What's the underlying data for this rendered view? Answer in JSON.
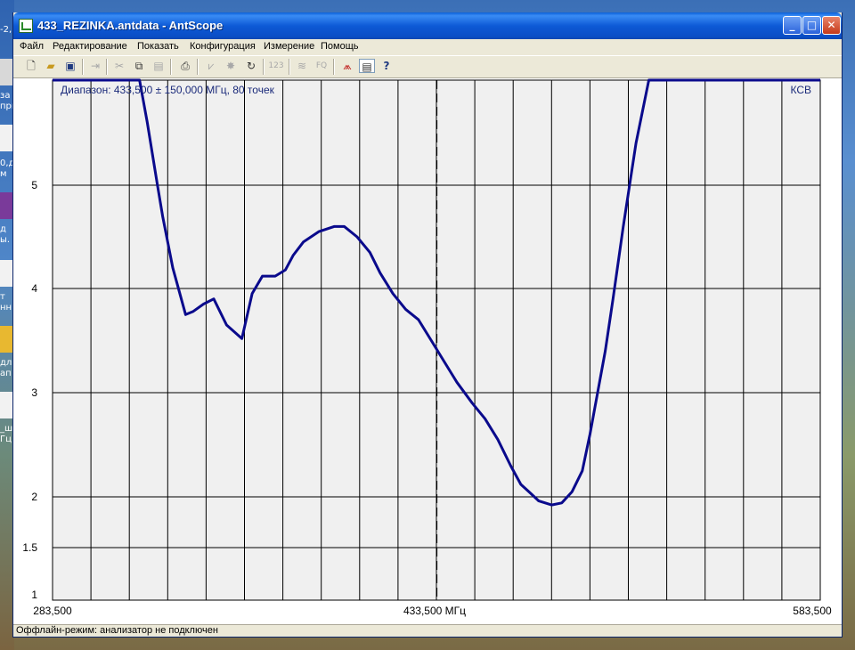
{
  "window": {
    "title": "433_REZINKA.antdata - AntScope",
    "buttons": {
      "minimize": "_",
      "maximize": "□",
      "close": "✕"
    }
  },
  "menu": [
    "Файл",
    "Редактирование",
    "Показать",
    "Конфигурация",
    "Измерение",
    "Помощь"
  ],
  "toolbar": {
    "tools": [
      "new-icon",
      "open-icon",
      "save-icon",
      "export-icon",
      "cut-icon",
      "copy-icon",
      "paste-icon",
      "print-icon",
      "graph-icon",
      "star-icon",
      "refresh-icon",
      "123-icon",
      "wifi-icon",
      "fq-icon",
      "chart-mode-icon",
      "table-icon",
      "help-icon"
    ],
    "labels": {
      "num": "123",
      "fq": "FQ",
      "help": "?"
    }
  },
  "desktop": {
    "labels": [
      "-2,",
      "за",
      "при",
      "0,д",
      "м",
      "д",
      "ы.",
      "т",
      "нн.",
      "дл",
      "ап",
      "_ш",
      "Гц"
    ]
  },
  "chart_data": {
    "type": "line",
    "title": "Диапазон: 433,500 ± 150,000 МГц, 80 точек",
    "ylabel": "КСВ",
    "xlim": [
      283.5,
      583.5
    ],
    "ylim_display": [
      1,
      6
    ],
    "y_ticks": [
      1,
      1.5,
      2,
      3,
      4,
      5
    ],
    "y_tick_labels": [
      "1",
      "1.5",
      "2",
      "3",
      "4",
      "5"
    ],
    "x_tick_labels": {
      "left": "283,500",
      "center": "433,500 МГц",
      "right": "583,500"
    },
    "center_marker": 433.5,
    "grid": true,
    "series": [
      {
        "color": "#0a0a8c",
        "x": [
          283.5,
          297.5,
          312.5,
          317.5,
          320.5,
          324.5,
          326.5,
          330.5,
          335.5,
          338.5,
          342.5,
          346.5,
          351.5,
          357.5,
          361.5,
          365.5,
          370.5,
          374.5,
          377.5,
          381.5,
          387.5,
          393.5,
          397.5,
          402.5,
          407.5,
          411.5,
          416.5,
          421.5,
          426.5,
          431.5,
          436.5,
          441.5,
          447.5,
          452.5,
          457.5,
          462.5,
          466.5,
          470.5,
          473.5,
          478.5,
          482.5,
          486.5,
          490.5,
          493.5,
          496.5,
          499.5,
          502.5,
          506.5,
          511.5,
          516.5,
          520.5,
          523.5,
          526.5,
          527.5,
          529.5,
          531.5,
          535.5,
          583.5
        ],
        "y": [
          6,
          6,
          6,
          6,
          5.6,
          5,
          4.7,
          4.2,
          3.75,
          3.78,
          3.85,
          3.9,
          3.65,
          3.52,
          3.95,
          4.12,
          4.12,
          4.18,
          4.32,
          4.45,
          4.55,
          4.6,
          4.6,
          4.5,
          4.35,
          4.15,
          3.95,
          3.8,
          3.7,
          3.5,
          3.3,
          3.1,
          2.9,
          2.75,
          2.55,
          2.3,
          2.12,
          2.03,
          1.96,
          1.92,
          1.94,
          2.05,
          2.25,
          2.6,
          3.0,
          3.4,
          3.9,
          4.6,
          5.4,
          6.0,
          6.3,
          6.6,
          6.9,
          6.7,
          6.1,
          6,
          6,
          6
        ]
      }
    ]
  },
  "status": {
    "text": "Оффлайн-режим: анализатор не подключен"
  },
  "colors": {
    "titlebar": "#0a5fd8",
    "line": "#0a0a8c",
    "plot_bg": "#f0f0f0"
  }
}
